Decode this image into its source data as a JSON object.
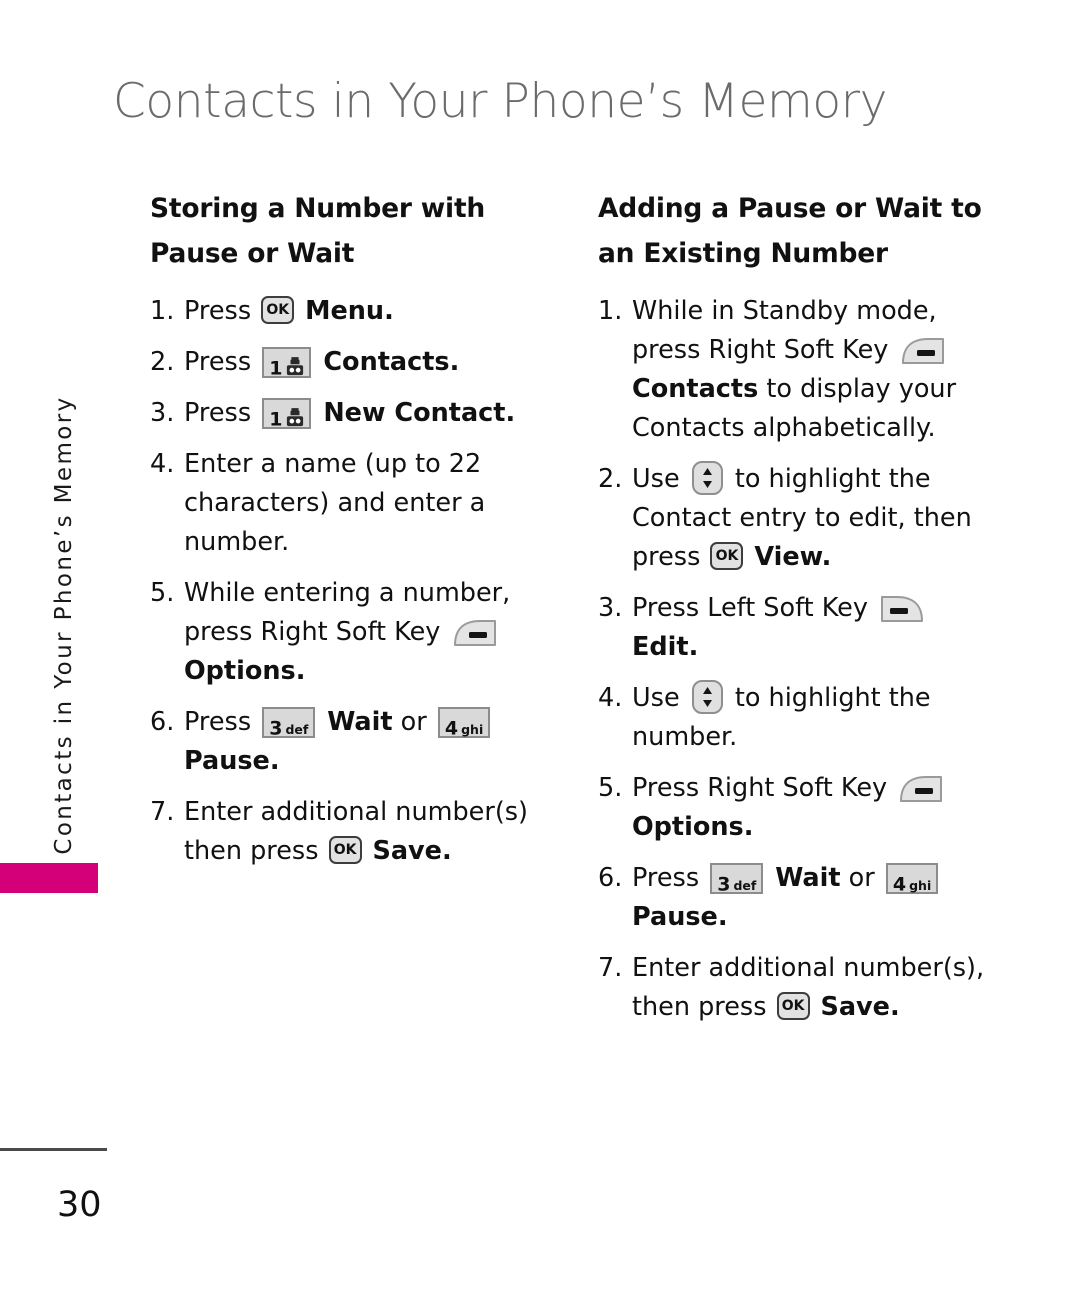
{
  "page": {
    "title": "Contacts in Your Phone’s Memory",
    "side_tab_text": "Contacts in Your Phone’s Memory",
    "side_tab_color": "#d4007a",
    "page_number": "30"
  },
  "keys": {
    "ok": "OK",
    "one_digit": "1",
    "one_label": "voicemail",
    "three_digit": "3",
    "three_label": "def",
    "four_digit": "4",
    "four_label": "ghi"
  },
  "left_column": {
    "heading": "Storing a Number with Pause or Wait",
    "steps": [
      {
        "num": "1.",
        "parts": [
          {
            "t": "text",
            "v": "Press "
          },
          {
            "t": "key-ok"
          },
          {
            "t": "bold",
            "v": " Menu."
          }
        ]
      },
      {
        "num": "2.",
        "parts": [
          {
            "t": "text",
            "v": "Press "
          },
          {
            "t": "key-one"
          },
          {
            "t": "bold",
            "v": " Contacts."
          }
        ]
      },
      {
        "num": "3.",
        "parts": [
          {
            "t": "text",
            "v": "Press "
          },
          {
            "t": "key-one"
          },
          {
            "t": "bold",
            "v": " New Contact."
          }
        ]
      },
      {
        "num": "4.",
        "parts": [
          {
            "t": "text",
            "v": "Enter a name (up to 22 characters) and enter a number."
          }
        ]
      },
      {
        "num": "5.",
        "parts": [
          {
            "t": "text",
            "v": "While entering a number, press Right Soft Key "
          },
          {
            "t": "key-soft-right"
          },
          {
            "t": "bold",
            "v": " Options."
          }
        ]
      },
      {
        "num": "6.",
        "parts": [
          {
            "t": "text",
            "v": "Press "
          },
          {
            "t": "key-three"
          },
          {
            "t": "bold",
            "v": " Wait"
          },
          {
            "t": "text",
            "v": " or "
          },
          {
            "t": "key-four"
          },
          {
            "t": "bold",
            "v": " Pause."
          }
        ]
      },
      {
        "num": "7.",
        "parts": [
          {
            "t": "text",
            "v": "Enter additional number(s) then press "
          },
          {
            "t": "key-ok"
          },
          {
            "t": "bold",
            "v": " Save."
          }
        ]
      }
    ]
  },
  "right_column": {
    "heading": "Adding a Pause or Wait to an Existing Number",
    "steps": [
      {
        "num": "1.",
        "parts": [
          {
            "t": "text",
            "v": "While in Standby mode, press Right Soft Key "
          },
          {
            "t": "key-soft-right"
          },
          {
            "t": "bold",
            "v": " Contacts"
          },
          {
            "t": "text",
            "v": " to display your Contacts alphabetically."
          }
        ]
      },
      {
        "num": "2.",
        "parts": [
          {
            "t": "text",
            "v": "Use "
          },
          {
            "t": "key-nav"
          },
          {
            "t": "text",
            "v": " to highlight the Contact entry to edit, then press "
          },
          {
            "t": "key-ok"
          },
          {
            "t": "bold",
            "v": " View."
          }
        ]
      },
      {
        "num": "3.",
        "parts": [
          {
            "t": "text",
            "v": "Press Left Soft Key "
          },
          {
            "t": "key-soft-left"
          },
          {
            "t": "bold",
            "v": " Edit."
          }
        ]
      },
      {
        "num": "4.",
        "parts": [
          {
            "t": "text",
            "v": "Use "
          },
          {
            "t": "key-nav"
          },
          {
            "t": "text",
            "v": " to highlight the number."
          }
        ]
      },
      {
        "num": "5.",
        "parts": [
          {
            "t": "text",
            "v": "Press Right Soft Key "
          },
          {
            "t": "key-soft-right"
          },
          {
            "t": "bold",
            "v": " Options."
          }
        ]
      },
      {
        "num": "6.",
        "parts": [
          {
            "t": "text",
            "v": "Press "
          },
          {
            "t": "key-three"
          },
          {
            "t": "bold",
            "v": " Wait"
          },
          {
            "t": "text",
            "v": " or "
          },
          {
            "t": "key-four"
          },
          {
            "t": "bold",
            "v": " Pause."
          }
        ]
      },
      {
        "num": "7.",
        "parts": [
          {
            "t": "text",
            "v": "Enter additional number(s), then press "
          },
          {
            "t": "key-ok"
          },
          {
            "t": "bold",
            "v": " Save."
          }
        ]
      }
    ]
  }
}
